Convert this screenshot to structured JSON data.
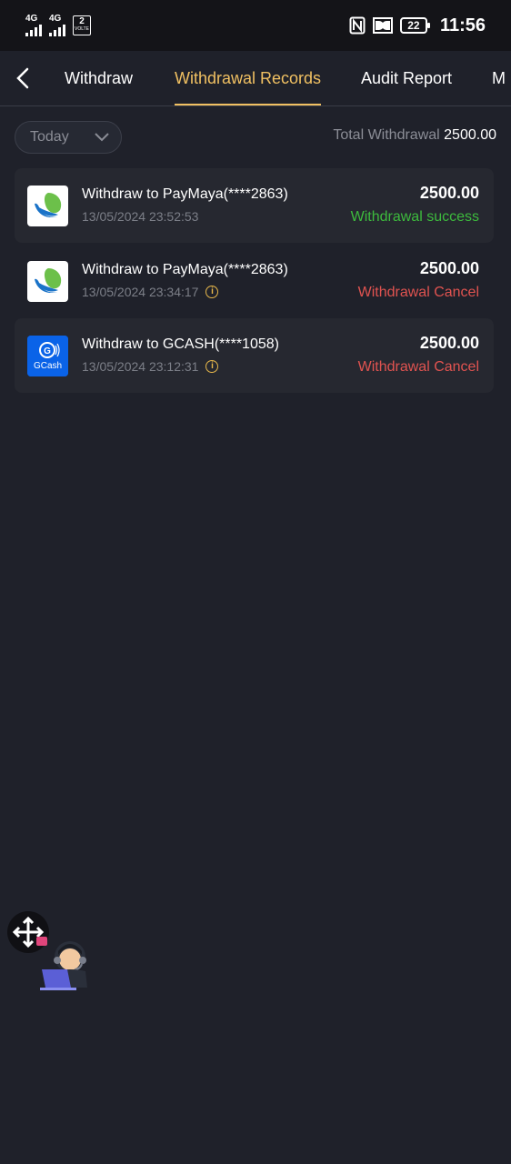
{
  "status_bar": {
    "net1": "4G",
    "net2": "4G",
    "volte_num": "2",
    "volte_text": "VOLTE",
    "battery": "22",
    "time": "11:56"
  },
  "tabs": [
    {
      "label": "Withdraw"
    },
    {
      "label": "Withdrawal Records"
    },
    {
      "label": "Audit Report"
    },
    {
      "label": "M"
    }
  ],
  "filter": {
    "label": "Today"
  },
  "total": {
    "label": "Total Withdrawal",
    "value": "2500.00"
  },
  "records": [
    {
      "logo": "paymaya-icon",
      "title": "Withdraw to PayMaya(****2863)",
      "date": "13/05/2024 23:52:53",
      "amount": "2500.00",
      "status": "Withdrawal success",
      "status_color": "#3dbb3d"
    },
    {
      "logo": "paymaya-icon",
      "title": "Withdraw to PayMaya(****2863)",
      "date": "13/05/2024 23:34:17",
      "amount": "2500.00",
      "status": "Withdrawal Cancel",
      "status_color": "#e05350"
    },
    {
      "logo": "gcash-icon",
      "logo_text": "GCash",
      "title": "Withdraw to GCASH(****1058)",
      "date": "13/05/2024 23:12:31",
      "amount": "2500.00",
      "status": "Withdrawal Cancel",
      "status_color": "#e05350"
    }
  ],
  "colors": {
    "accent": "#f0c062",
    "background": "#1f212a",
    "card": "#262830"
  }
}
